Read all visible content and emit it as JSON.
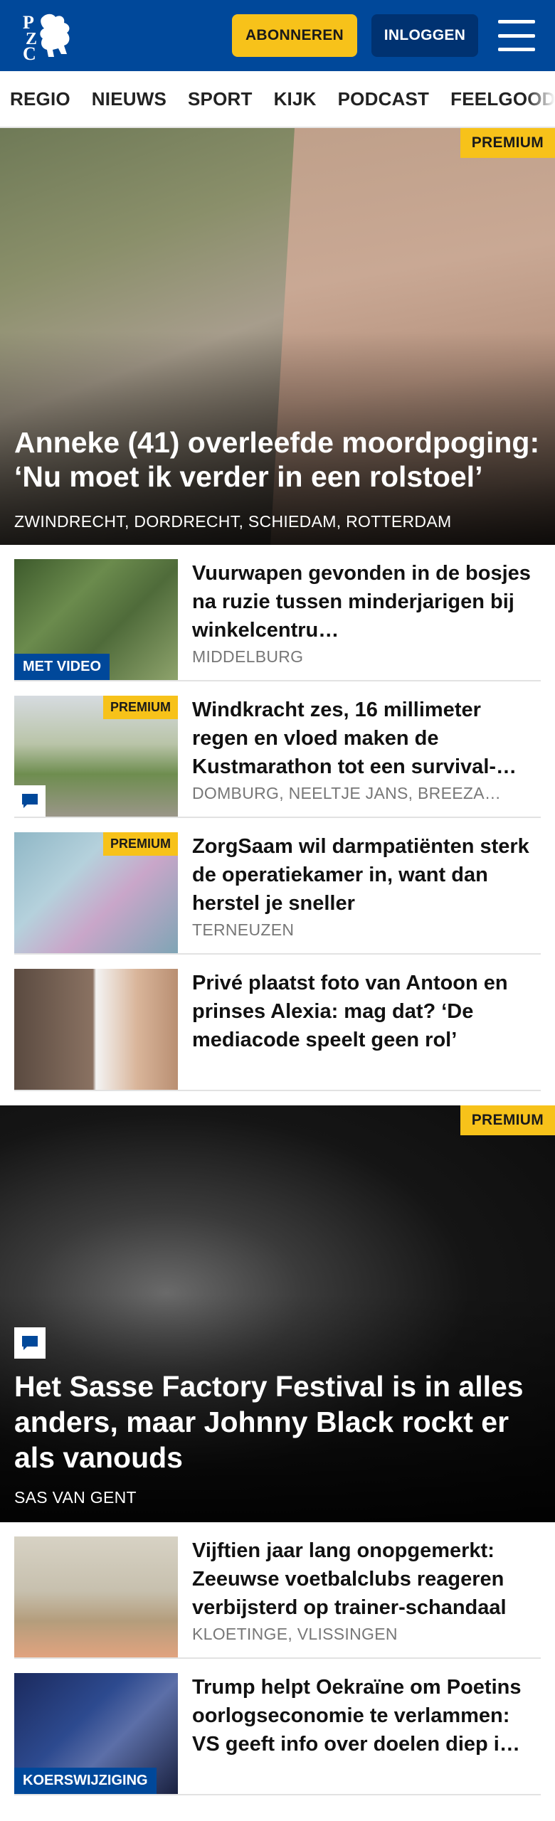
{
  "header": {
    "brand_colors": {
      "primary": "#00489a",
      "accent": "#f7c21a",
      "login_bg": "#003271"
    },
    "logo_icon": "pzc-lion-logo",
    "subscribe_label": "ABONNEREN",
    "login_label": "INLOGGEN",
    "menu_icon": "hamburger-icon"
  },
  "nav": {
    "items": [
      "REGIO",
      "NIEUWS",
      "SPORT",
      "KIJK",
      "PODCAST",
      "FEELGOOD"
    ]
  },
  "hero": {
    "badge": "PREMIUM",
    "title": "Anneke (41) overleefde moordpoging: ‘Nu moet ik verder in een rolstoel’",
    "location": "ZWINDRECHT, DORDRECHT, SCHIEDAM, ROTTERDAM"
  },
  "list1": [
    {
      "title": "Vuurwapen gevonden in de bosjes na ruzie tussen minderjarigen bij winkelcentru…",
      "location": "MIDDELBURG",
      "label": "MET VIDEO"
    },
    {
      "title": "Windkracht zes, 16 millimeter regen en vloed maken de Kustmarathon tot een survival-…",
      "location": "DOMBURG, NEELTJE JANS, BREEZA…",
      "badge": "PREMIUM",
      "comment_icon": "comment-icon"
    },
    {
      "title": "ZorgSaam wil darmpatiënten sterk de operatiekamer in, want dan herstel je sneller",
      "location": "TERNEUZEN",
      "badge": "PREMIUM"
    },
    {
      "title": "Privé plaatst foto van Antoon en prinses Alexia: mag dat? ‘De mediacode speelt geen rol’",
      "location": ""
    }
  ],
  "feature": {
    "badge": "PREMIUM",
    "comment_icon": "comment-icon",
    "title": "Het Sasse Factory Festival is in alles anders, maar Johnny Black rockt er als vanouds",
    "location": "SAS VAN GENT"
  },
  "list2": [
    {
      "title": "Vijftien jaar lang onopgemerkt: Zeeuwse voetbalclubs reageren verbijsterd op trainer-schandaal",
      "location": "KLOETINGE, VLISSINGEN"
    },
    {
      "title": "Trump helpt Oekraïne om Poetins oorlogseconomie te verlammen: VS geeft info over doelen diep i…",
      "location": "",
      "label": "KOERSWIJZIGING"
    }
  ]
}
